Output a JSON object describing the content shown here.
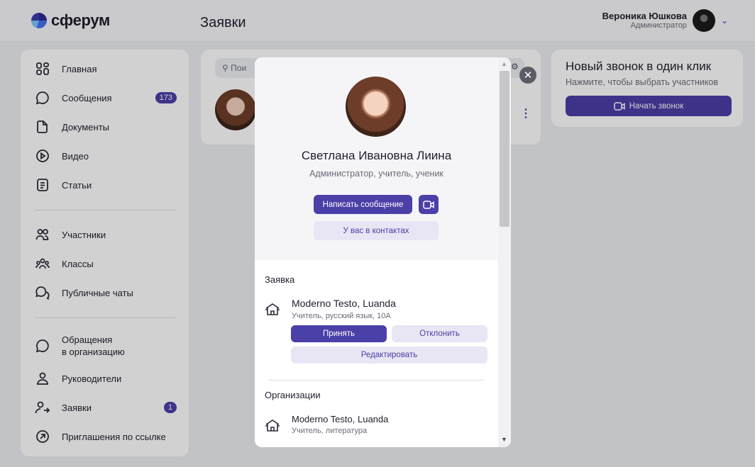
{
  "header": {
    "logo_text": "сферум",
    "page_title": "Заявки",
    "user_name": "Вероника Юшкова",
    "user_role": "Администратор"
  },
  "sidebar": {
    "items": [
      {
        "label": "Главная",
        "icon": "home-grid-icon"
      },
      {
        "label": "Сообщения",
        "icon": "chat-bubble-icon",
        "badge": "173"
      },
      {
        "label": "Документы",
        "icon": "document-icon"
      },
      {
        "label": "Видео",
        "icon": "play-icon"
      },
      {
        "label": "Статьи",
        "icon": "article-icon"
      },
      {
        "label": "Участники",
        "icon": "people-icon"
      },
      {
        "label": "Классы",
        "icon": "class-group-icon"
      },
      {
        "label": "Публичные чаты",
        "icon": "public-chat-icon"
      },
      {
        "label": "Обращения\nв организацию",
        "icon": "appeal-chat-icon"
      },
      {
        "label": "Руководители",
        "icon": "person-icon"
      },
      {
        "label": "Заявки",
        "icon": "person-arrow-icon",
        "badge": "1"
      },
      {
        "label": "Приглашения по ссылке",
        "icon": "link-arrow-icon"
      }
    ]
  },
  "center": {
    "search_placeholder": "Пои"
  },
  "call_card": {
    "title": "Новый звонок в один клик",
    "subtitle": "Нажмите, чтобы выбрать участников",
    "button": "Начать звонок"
  },
  "modal": {
    "profile_name": "Светлана Ивановна Лиина",
    "profile_roles": "Администратор, учитель, ученик",
    "write_message": "Написать сообщение",
    "in_contacts": "У вас в контактах",
    "request_section": "Заявка",
    "request_org": "Moderno Testo, Luanda",
    "request_details": "Учитель, русский язык, 10А",
    "accept": "Принять",
    "decline": "Отклонить",
    "edit": "Редактировать",
    "orgs_section": "Организации",
    "org_name": "Moderno Testo, Luanda",
    "org_details": "Учитель, литература"
  },
  "colors": {
    "accent": "#4b3fa8",
    "accent_light": "#e8e6f4",
    "background": "#eceef2"
  }
}
